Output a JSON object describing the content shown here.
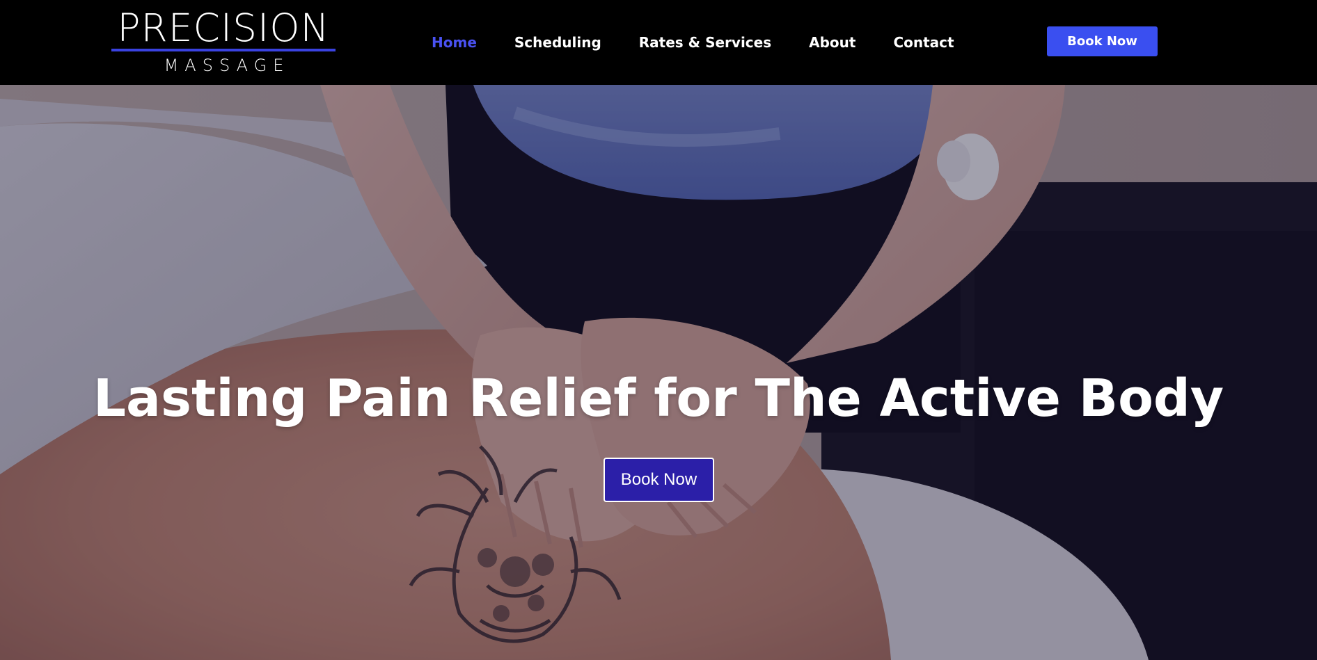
{
  "logo": {
    "main": "PRECISION",
    "sub": "MASSAGE",
    "accent_color": "#3a42e0"
  },
  "nav": {
    "items": [
      {
        "label": "Home",
        "active": true
      },
      {
        "label": "Scheduling",
        "active": false
      },
      {
        "label": "Rates & Services",
        "active": false
      },
      {
        "label": "About",
        "active": false
      },
      {
        "label": "Contact",
        "active": false
      }
    ],
    "active_color": "#4a52f2"
  },
  "header": {
    "book_label": "Book Now",
    "book_color": "#3a4ff0"
  },
  "hero": {
    "title": "Lasting Pain Relief for The Active Body",
    "book_label": "Book Now",
    "book_color": "#2b1fa8"
  }
}
